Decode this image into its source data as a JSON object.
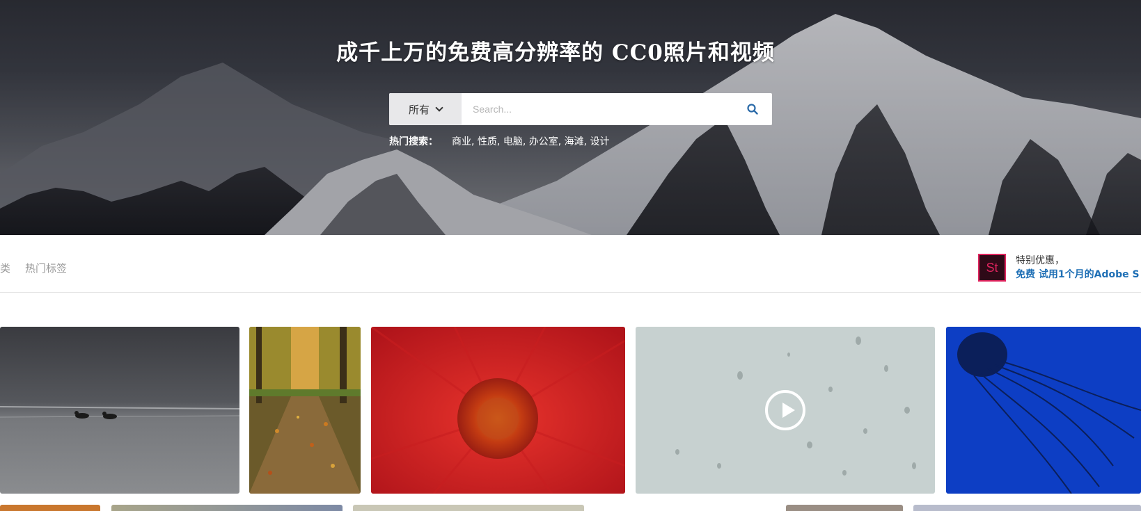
{
  "hero": {
    "title": "成千上万的免费高分辨率的 CC0照片和视频",
    "search": {
      "category_selected": "所有",
      "placeholder": "Search...",
      "icon": "search-icon"
    },
    "hot_search": {
      "label": "热门搜索：",
      "links": [
        "商业",
        "性质",
        "电脑",
        "办公室",
        "海滩",
        "设计"
      ]
    }
  },
  "nav": {
    "items": [
      "类",
      "热门标签"
    ]
  },
  "promo": {
    "logo_text": "St",
    "line1": "特别优惠，",
    "line2": "免费 试用1个月的Adobe S"
  },
  "gallery": {
    "row1": [
      "lake-birds-photo",
      "autumn-path-photo",
      "red-flower-photo",
      "raindrops-video",
      "jellyfish-photo"
    ],
    "video_icon": "play-icon"
  },
  "colors": {
    "accent_blue": "#1e6fb5",
    "adobe_pink": "#e0245e"
  }
}
